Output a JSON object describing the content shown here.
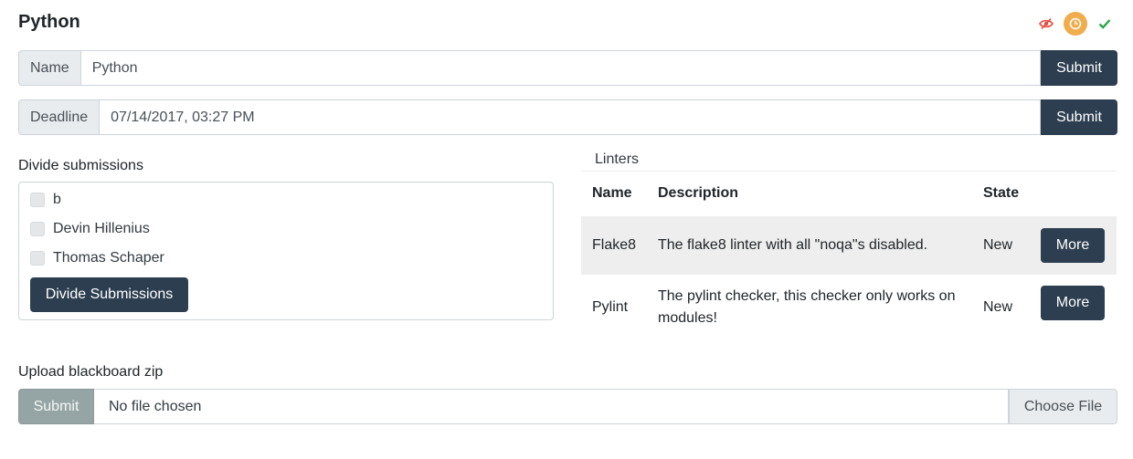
{
  "page": {
    "title": "Python"
  },
  "status_icons": [
    {
      "name": "hidden-eye-icon",
      "color": "#e74c3c"
    },
    {
      "name": "clock-icon",
      "color": "#f0ad4e"
    },
    {
      "name": "checkmark-icon",
      "color": "#28a745"
    }
  ],
  "name_form": {
    "label": "Name",
    "value": "Python",
    "submit_label": "Submit"
  },
  "deadline_form": {
    "label": "Deadline",
    "value": "07/14/2017, 03:27 PM",
    "submit_label": "Submit"
  },
  "divide": {
    "title": "Divide submissions",
    "users": [
      "b",
      "Devin Hillenius",
      "Thomas Schaper"
    ],
    "button_label": "Divide Submissions"
  },
  "linters": {
    "title": "Linters",
    "columns": [
      "Name",
      "Description",
      "State"
    ],
    "rows": [
      {
        "name": "Flake8",
        "description": "The flake8 linter with all \"noqa\"s disabled.",
        "state": "New",
        "button": "More"
      },
      {
        "name": "Pylint",
        "description": "The pylint checker, this checker only works on modules!",
        "state": "New",
        "button": "More"
      }
    ]
  },
  "upload": {
    "title": "Upload blackboard zip",
    "submit_label": "Submit",
    "file_text": "No file chosen",
    "choose_label": "Choose File"
  }
}
